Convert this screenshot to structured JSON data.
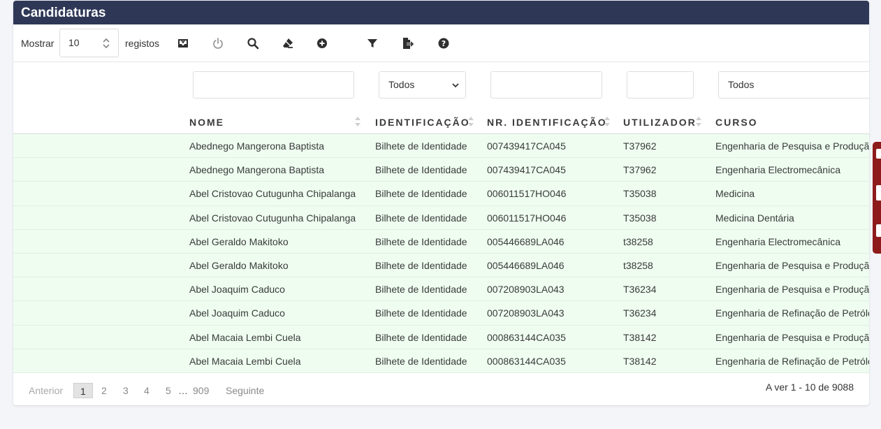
{
  "header": {
    "title": "Candidaturas"
  },
  "toolbar": {
    "show_label": "Mostrar",
    "page_length": "10",
    "records_label": "registos",
    "buttons": [
      "inbox-icon",
      "power-icon",
      "search-icon",
      "eraser-icon",
      "plus-circle-icon",
      "filter-icon",
      "export-icon",
      "help-icon"
    ]
  },
  "filters": {
    "nome": "",
    "identificacao": "Todos",
    "nr_identificacao": "",
    "utilizador": "",
    "curso": "Todos"
  },
  "columns": [
    "NOME",
    "IDENTIFICAÇÃO",
    "NR. IDENTIFICAÇÃO",
    "UTILIZADOR",
    "CURSO"
  ],
  "rows": [
    [
      "Abednego Mangerona Baptista",
      "Bilhete de Identidade",
      "007439417CA045",
      "T37962",
      "Engenharia de Pesquisa e Produção"
    ],
    [
      "Abednego Mangerona Baptista",
      "Bilhete de Identidade",
      "007439417CA045",
      "T37962",
      "Engenharia Electromecânica"
    ],
    [
      "Abel Cristovao Cutugunha Chipalanga",
      "Bilhete de Identidade",
      "006011517HO046",
      "T35038",
      "Medicina"
    ],
    [
      "Abel Cristovao Cutugunha Chipalanga",
      "Bilhete de Identidade",
      "006011517HO046",
      "T35038",
      "Medicina Dentária"
    ],
    [
      "Abel Geraldo Makitoko",
      "Bilhete de Identidade",
      "005446689LA046",
      "t38258",
      "Engenharia Electromecânica"
    ],
    [
      "Abel Geraldo Makitoko",
      "Bilhete de Identidade",
      "005446689LA046",
      "t38258",
      "Engenharia de Pesquisa e Produção"
    ],
    [
      "Abel Joaquim Caduco",
      "Bilhete de Identidade",
      "007208903LA043",
      "T36234",
      "Engenharia de Pesquisa e Produção"
    ],
    [
      "Abel Joaquim Caduco",
      "Bilhete de Identidade",
      "007208903LA043",
      "T36234",
      "Engenharia de Refinação de Petróleo"
    ],
    [
      "Abel Macaia Lembi Cuela",
      "Bilhete de Identidade",
      "000863144CA035",
      "T38142",
      "Engenharia de Pesquisa e Produção"
    ],
    [
      "Abel Macaia Lembi Cuela",
      "Bilhete de Identidade",
      "000863144CA035",
      "T38142",
      "Engenharia de Refinação de Petróleo"
    ]
  ],
  "pagination": {
    "previous": "Anterior",
    "pages": [
      "1",
      "2",
      "3",
      "4",
      "5"
    ],
    "ellipsis": "…",
    "last": "909",
    "next": "Seguinte",
    "info": "A ver 1 - 10 de 9088"
  },
  "colors": {
    "header_bg": "#2e3856",
    "row_bg": "#eefdf0",
    "side_tab": "#8e1b1b"
  }
}
